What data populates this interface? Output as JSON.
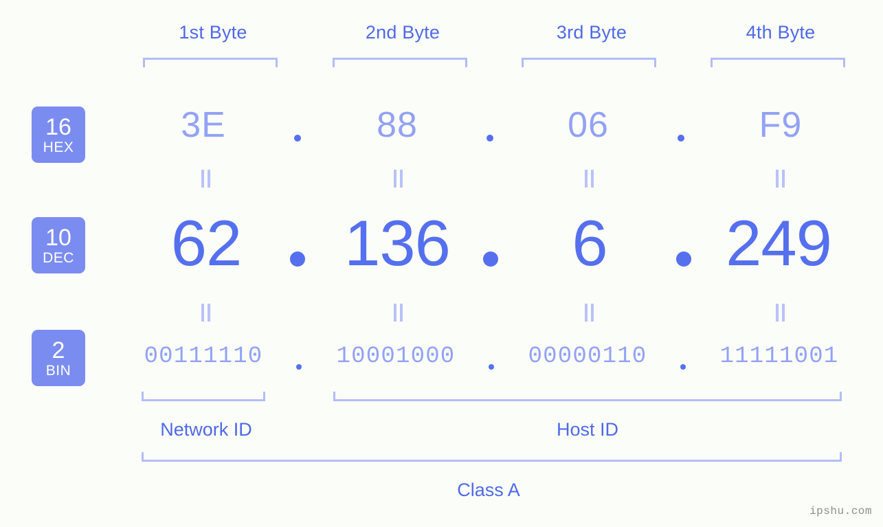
{
  "watermark": "ipshu.com",
  "byte_headers": [
    {
      "label": "1st Byte"
    },
    {
      "label": "2nd Byte"
    },
    {
      "label": "3rd Byte"
    },
    {
      "label": "4th Byte"
    }
  ],
  "bases": [
    {
      "number": "16",
      "word": "HEX"
    },
    {
      "number": "10",
      "word": "DEC"
    },
    {
      "number": "2",
      "word": "BIN"
    }
  ],
  "rows": {
    "hex": {
      "values": [
        "3E",
        "88",
        "06",
        "F9"
      ]
    },
    "dec": {
      "values": [
        "62",
        "136",
        "6",
        "249"
      ]
    },
    "bin": {
      "values": [
        "00111110",
        "10001000",
        "00000110",
        "11111001"
      ]
    }
  },
  "separators": {
    "symbol": "."
  },
  "equals": {
    "symbol": "="
  },
  "sections": [
    {
      "label": "Network ID"
    },
    {
      "label": "Host ID"
    }
  ],
  "class_label": "Class A",
  "colors": {
    "background": "#fbfdf8",
    "badge_bg": "#7b8cf0",
    "badge_text": "#ffffff",
    "header_text": "#4f6ae8",
    "bracket": "#b3bdf7",
    "hex_value": "#93a2f4",
    "dec_value": "#5570ee",
    "bin_value": "#93a2f4",
    "dot": "#5570ee",
    "equals": "#b9c2f8",
    "watermark": "#8e8e8e"
  }
}
